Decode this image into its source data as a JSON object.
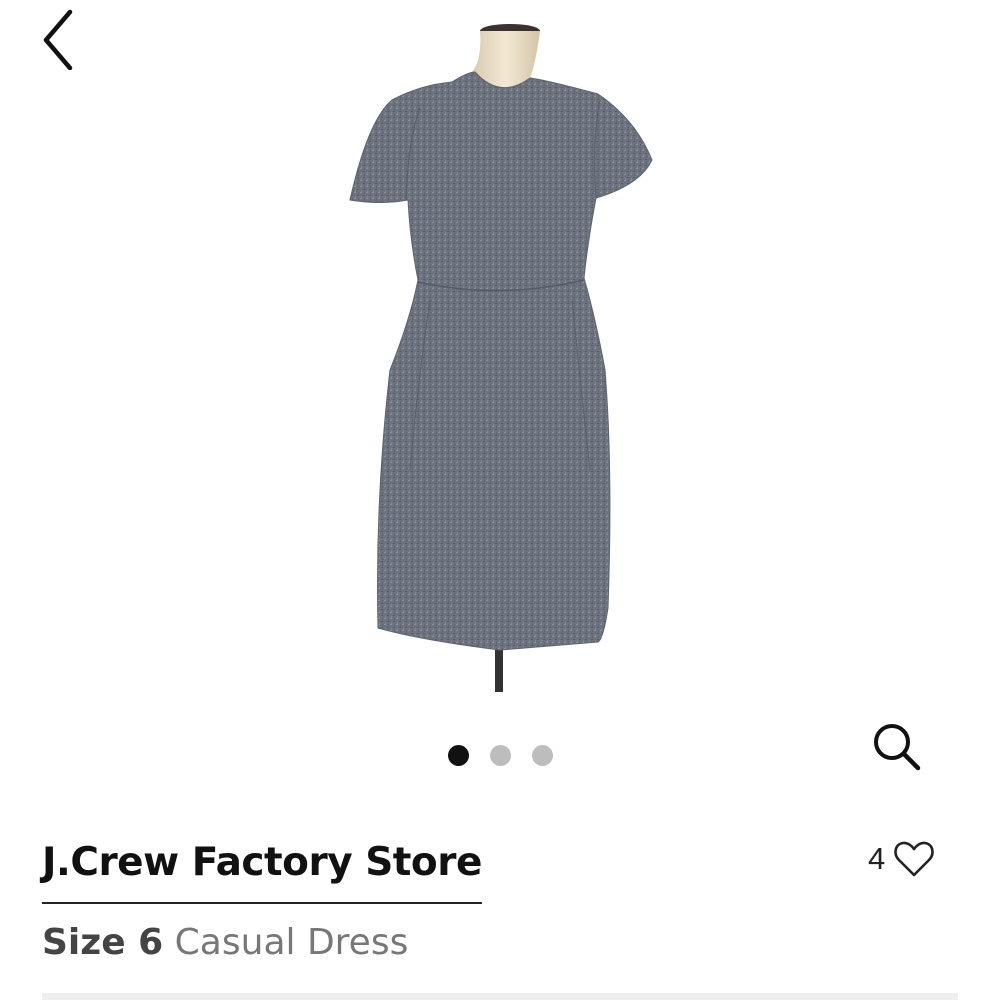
{
  "header": {
    "back_icon": "chevron-left-icon"
  },
  "product": {
    "brand": "J.Crew Factory Store",
    "size_label": "Size 6",
    "category": "Casual Dress",
    "favorite_count": "4",
    "favorite_icon": "heart-outline-icon",
    "zoom_icon": "magnifier-icon",
    "image_alt": "gray tweed short sleeve dress on mannequin"
  },
  "carousel": {
    "total": 3,
    "active_index": 0
  },
  "colors": {
    "dress": "#6f7682",
    "dot_active": "#111111",
    "dot_inactive": "#bdbdbd"
  }
}
